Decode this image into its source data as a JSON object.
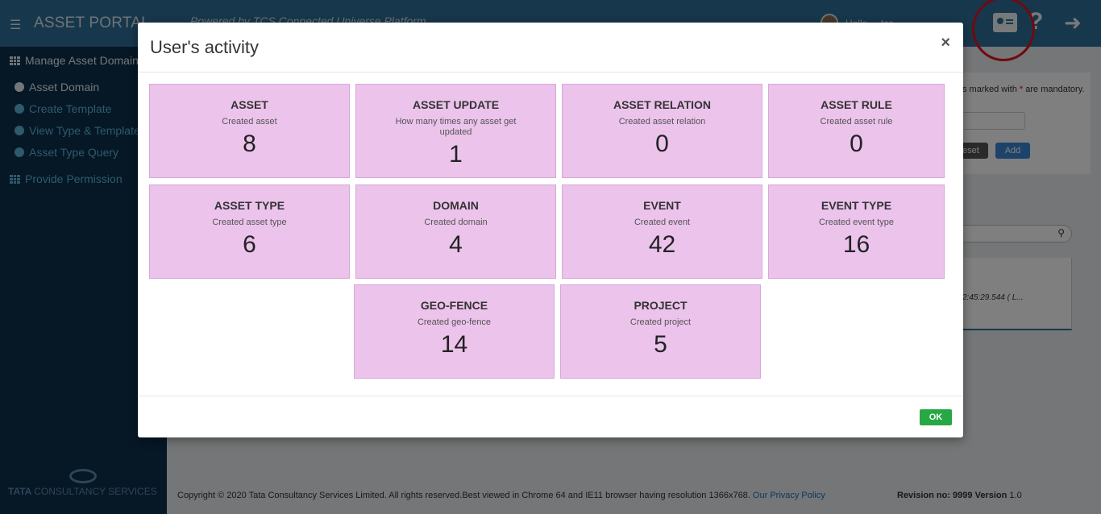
{
  "header": {
    "menu_icon": "hamburger-icon",
    "app_title": "ASSET PORTAL",
    "tagline": "Powered by TCS Connected Universe Platform",
    "greeting": "Hello ... tcs",
    "icons": [
      "profile-card-icon",
      "help-icon",
      "logout-icon"
    ]
  },
  "sidebar": {
    "group_manage": "Manage Asset Domain",
    "items": [
      {
        "label": "Asset Domain",
        "active": true
      },
      {
        "label": "Create Template",
        "active": false
      },
      {
        "label": "View Type & Template",
        "active": false
      },
      {
        "label": "Asset Type Query",
        "active": false
      }
    ],
    "group_permission": "Provide Permission",
    "brand_bold": "TATA",
    "brand_rest": "CONSULTANCY SERVICES"
  },
  "main": {
    "mandatory_note": "s marked with",
    "mandatory_star": "*",
    "mandatory_tail": "are mandatory.",
    "reset_label": "eset",
    "add_label": "Add",
    "timestamp": "2:45:29.544 ( L..."
  },
  "footer": {
    "copyright": "Copyright © 2020 Tata Consultancy Services Limited. All rights reserved.Best viewed in Chrome 64 and IE11 browser having resolution 1366x768.",
    "privacy_link": "Our Privacy Policy",
    "revision_label": "Revision no: 9999 Version",
    "version": "1.0"
  },
  "modal": {
    "title": "User's activity",
    "close_label": "×",
    "ok_label": "OK",
    "tiles": [
      {
        "title": "ASSET",
        "subtitle": "Created asset",
        "value": "8"
      },
      {
        "title": "ASSET UPDATE",
        "subtitle": "How many times any asset get updated",
        "value": "1"
      },
      {
        "title": "ASSET RELATION",
        "subtitle": "Created asset relation",
        "value": "0"
      },
      {
        "title": "ASSET RULE",
        "subtitle": "Created asset rule",
        "value": "0"
      },
      {
        "title": "ASSET TYPE",
        "subtitle": "Created asset type",
        "value": "6"
      },
      {
        "title": "DOMAIN",
        "subtitle": "Created domain",
        "value": "4"
      },
      {
        "title": "EVENT",
        "subtitle": "Created event",
        "value": "42"
      },
      {
        "title": "EVENT TYPE",
        "subtitle": "Created event type",
        "value": "16"
      },
      {
        "title": "GEO-FENCE",
        "subtitle": "Created geo-fence",
        "value": "14"
      },
      {
        "title": "PROJECT",
        "subtitle": "Created project",
        "value": "5"
      }
    ]
  },
  "colors": {
    "topbar": "#2e6f98",
    "sidebar": "#0c2f4c",
    "tile_bg": "#ebc3eb",
    "ok_button": "#28a745",
    "highlight_ring": "#e0141e"
  }
}
